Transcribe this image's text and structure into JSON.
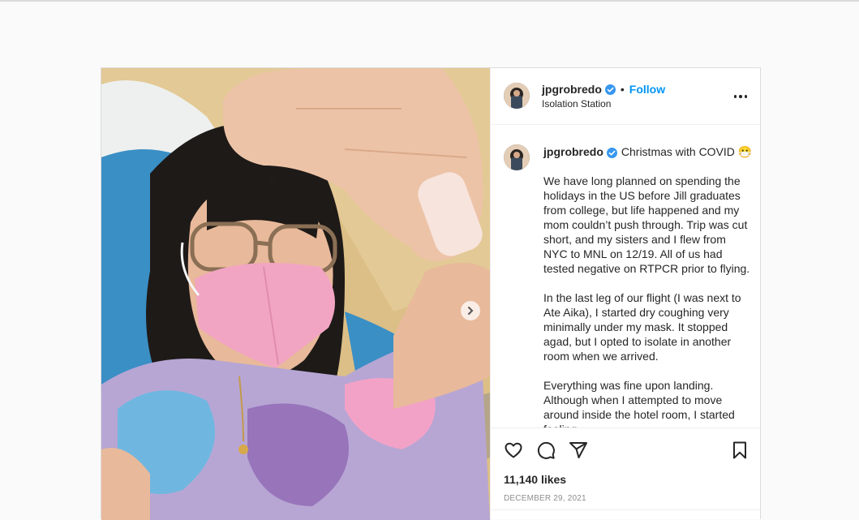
{
  "post": {
    "username": "jpgrobredo",
    "follow_label": "Follow",
    "dot": "•",
    "location": "Isolation Station",
    "caption_title": "Christmas with COVID 😷",
    "caption_paragraphs": [
      "We have long planned on spending the holidays in the US before Jill graduates from college, but life happened and my mom couldn’t push through. Trip was cut short, and my sisters and I flew from NYC to MNL on 12/19. All of us had tested negative on RTPCR prior to flying.",
      "In the last leg of our flight (I was next to Ate Aika), I started dry coughing very minimally under my mask. It stopped agad, but I opted to isolate in another room when we arrived.",
      "Everything was fine upon landing. Although when I attempted to move around inside the hotel room, I started feeling"
    ],
    "likes": "11,140 likes",
    "date": "DECEMBER 29, 2021"
  },
  "icons": {
    "verified": "verified-badge-icon",
    "more": "more-options-icon",
    "like": "heart-icon",
    "comment": "comment-icon",
    "share": "share-icon",
    "save": "bookmark-icon",
    "next": "chevron-right-icon"
  },
  "colors": {
    "accent": "#0095f6",
    "text": "#262626",
    "muted": "#8e8e8e",
    "border": "#dbdbdb"
  }
}
